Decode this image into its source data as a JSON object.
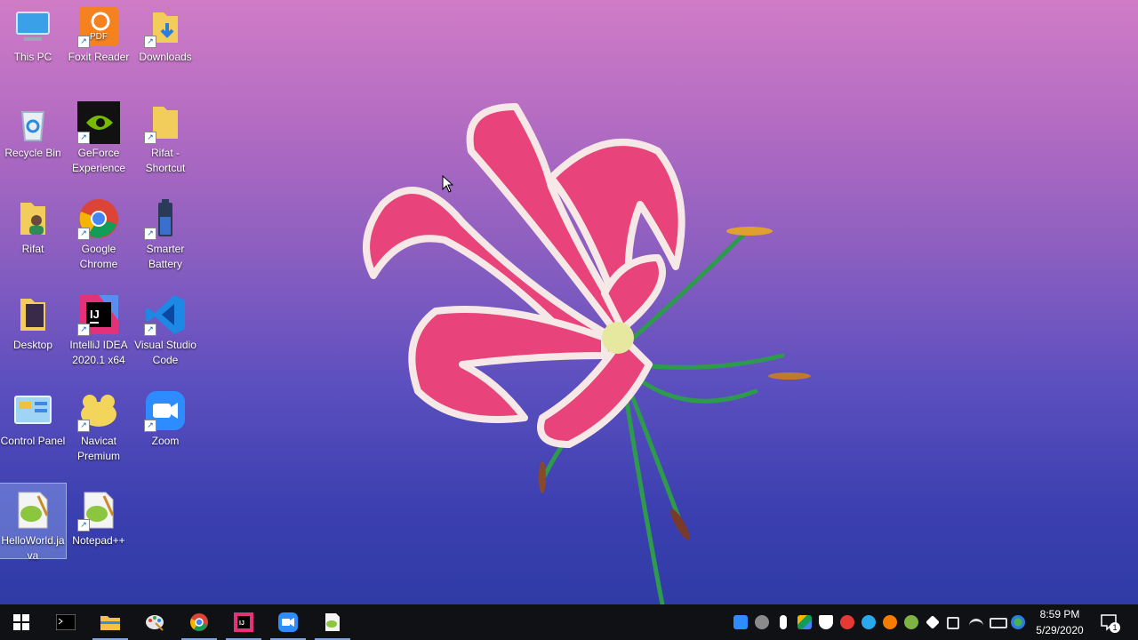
{
  "desktop": {
    "icons": [
      {
        "label": "This PC",
        "icon": "monitor-icon"
      },
      {
        "label": "Foxit Reader",
        "icon": "pdf-icon"
      },
      {
        "label": "Downloads",
        "icon": "folder-icon"
      },
      {
        "label": "Recycle Bin",
        "icon": "recycle-bin-icon"
      },
      {
        "label": "GeForce Experience",
        "icon": "nvidia-icon"
      },
      {
        "label": "Rifat - Shortcut",
        "icon": "folder-icon"
      },
      {
        "label": "Rifat",
        "icon": "user-folder-icon"
      },
      {
        "label": "Google Chrome",
        "icon": "chrome-icon"
      },
      {
        "label": "Smarter Battery",
        "icon": "battery-icon"
      },
      {
        "label": "Desktop",
        "icon": "folder-icon"
      },
      {
        "label": "IntelliJ IDEA 2020.1 x64",
        "icon": "intellij-icon"
      },
      {
        "label": "Visual Studio Code",
        "icon": "vscode-icon"
      },
      {
        "label": "Control Panel",
        "icon": "control-panel-icon"
      },
      {
        "label": "Navicat Premium",
        "icon": "navicat-icon"
      },
      {
        "label": "Zoom",
        "icon": "zoom-icon"
      },
      {
        "label": "HelloWorld.java",
        "icon": "notepadpp-file-icon"
      },
      {
        "label": "Notepad++",
        "icon": "notepadpp-icon"
      }
    ]
  },
  "taskbar": {
    "apps": [
      "windows-start-icon",
      "terminal-icon",
      "file-explorer-icon",
      "paint-icon",
      "chrome-icon",
      "intellij-icon",
      "zoom-icon",
      "notepadpp-icon"
    ],
    "clock": {
      "time": "8:59 PM",
      "date": "5/29/2020"
    },
    "notification_count": "1"
  },
  "colors": {
    "taskbar": "#101114",
    "accent": "#7aa8e0"
  }
}
